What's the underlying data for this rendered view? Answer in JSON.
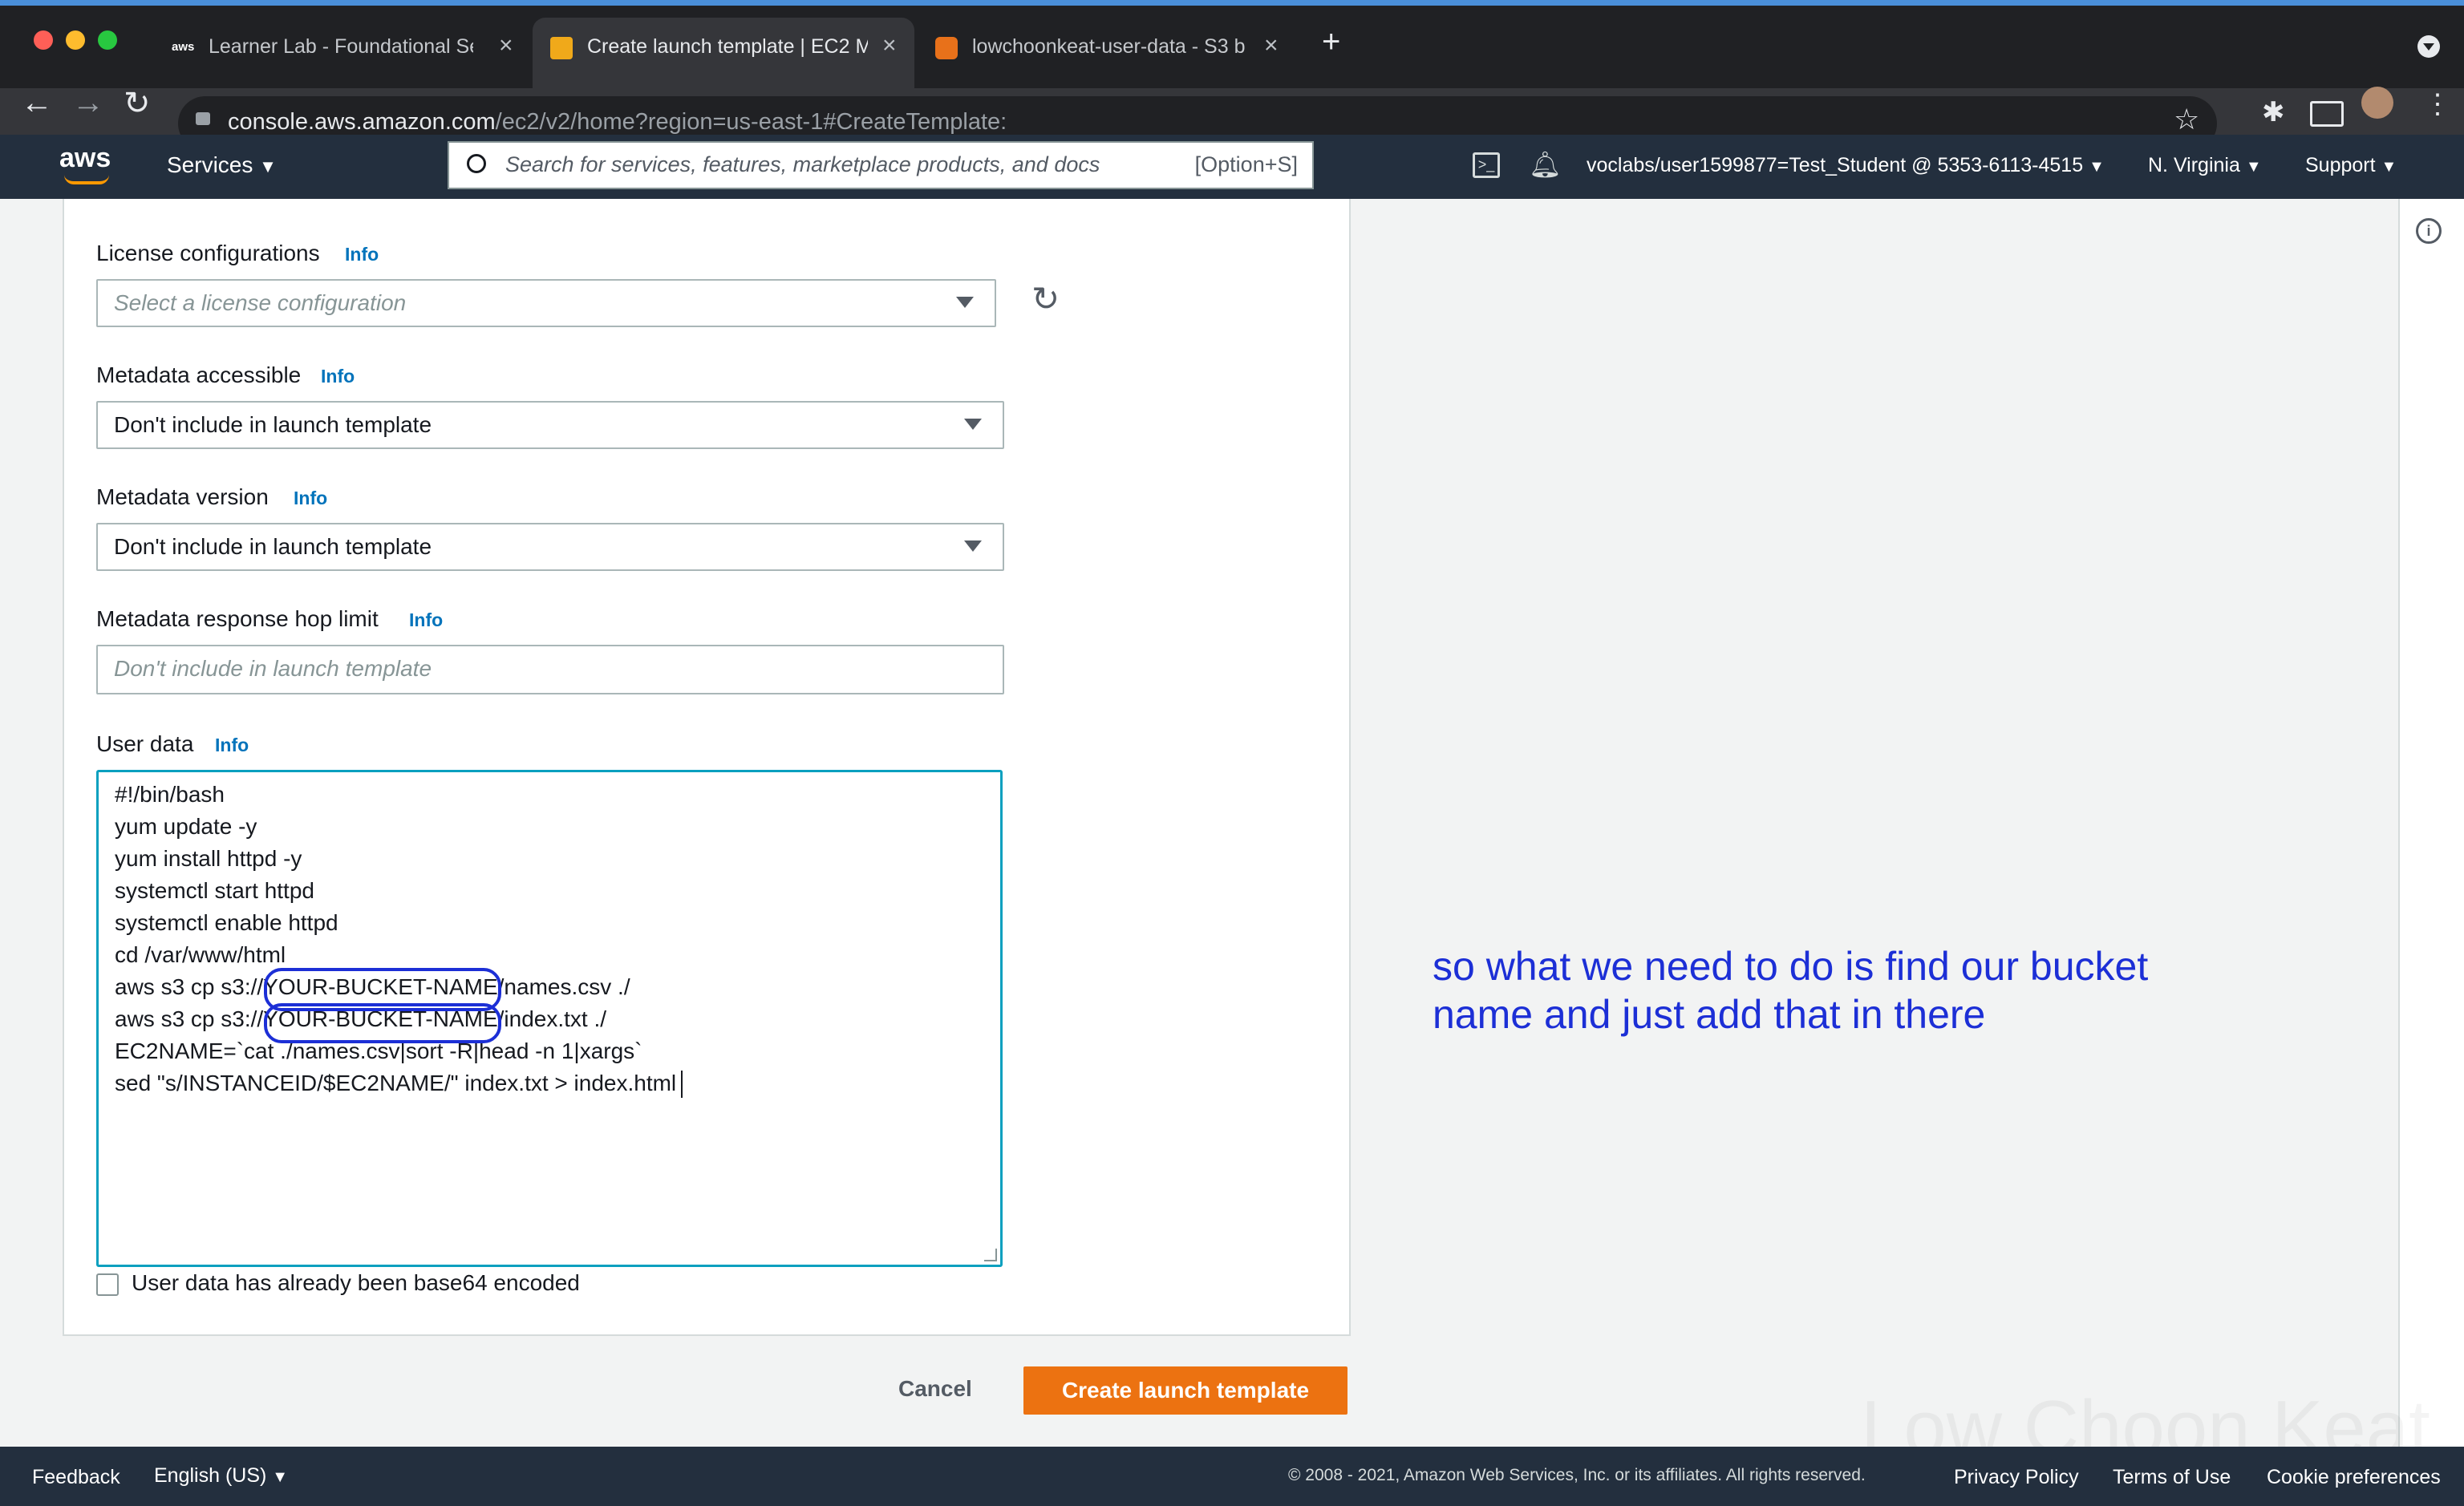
{
  "browser": {
    "tabs": [
      {
        "title": "Learner Lab - Foundational Ser",
        "favicon": "aws-icon"
      },
      {
        "title": "Create launch template | EC2 M",
        "favicon": "ec2-icon",
        "active": true
      },
      {
        "title": "lowchoonkeat-user-data - S3 b",
        "favicon": "s3-icon"
      }
    ],
    "url_domain": "console.aws.amazon.com",
    "url_path": "/ec2/v2/home?region=us-east-1#CreateTemplate:"
  },
  "aws_header": {
    "logo": "aws",
    "services_label": "Services",
    "search_placeholder": "Search for services, features, marketplace products, and docs",
    "search_shortcut": "[Option+S]",
    "account": "voclabs/user1599877=Test_Student @ 5353-6113-4515",
    "region": "N. Virginia",
    "support": "Support"
  },
  "form": {
    "info_label": "Info",
    "license": {
      "label": "License configurations",
      "placeholder": "Select a license configuration"
    },
    "metadata_accessible": {
      "label": "Metadata accessible",
      "value": "Don't include in launch template"
    },
    "metadata_version": {
      "label": "Metadata version",
      "value": "Don't include in launch template"
    },
    "hop_limit": {
      "label": "Metadata response hop limit",
      "placeholder": "Don't include in launch template"
    },
    "user_data": {
      "label": "User data",
      "lines": [
        "#!/bin/bash",
        "yum update -y",
        "yum install httpd -y",
        "systemctl start httpd",
        "systemctl enable httpd",
        "cd /var/www/html",
        "aws s3 cp s3://YOUR-BUCKET-NAME/names.csv ./",
        "aws s3 cp s3://YOUR-BUCKET-NAME/index.txt ./",
        "EC2NAME=`cat ./names.csv|sort -R|head -n 1|xargs`",
        "sed \"s/INSTANCEID/$EC2NAME/\" index.txt > index.html"
      ],
      "base64_label": "User data has already been base64 encoded",
      "base64_checked": false
    },
    "cancel": "Cancel",
    "create": "Create launch template"
  },
  "annotation": {
    "text_line1": "so what we need to do is find our bucket",
    "text_line2": "name and just add that in there",
    "color": "#1c2fd6"
  },
  "watermark": "Low Choon Keat",
  "footer": {
    "feedback": "Feedback",
    "language": "English (US)",
    "copyright": "© 2008 - 2021, Amazon Web Services, Inc. or its affiliates. All rights reserved.",
    "privacy": "Privacy Policy",
    "terms": "Terms of Use",
    "cookies": "Cookie preferences"
  },
  "colors": {
    "aws_header": "#232f3e",
    "primary_button": "#ec7211",
    "link": "#0073bb"
  }
}
